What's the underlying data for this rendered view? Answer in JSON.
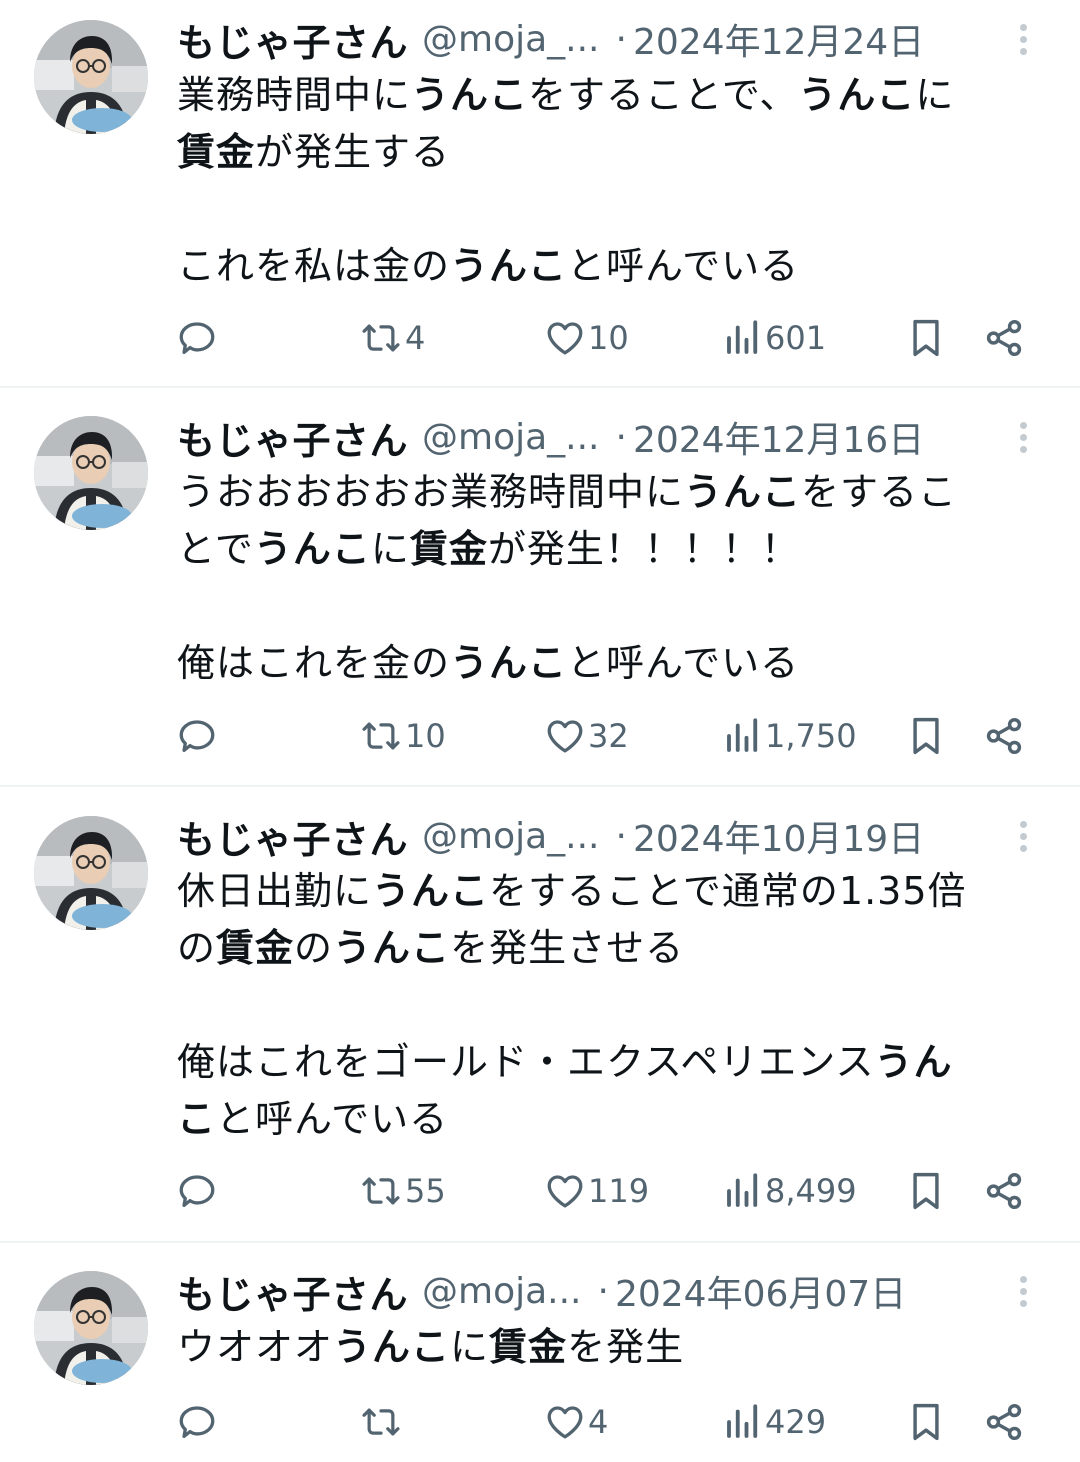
{
  "tweets": [
    {
      "name": "もじゃ子さん",
      "handle": "@moja_...",
      "separator": "·",
      "date": "2024年12月24日",
      "lines": [
        [
          {
            "t": "業務時間中に",
            "b": false
          },
          {
            "t": "うんこ",
            "b": true
          },
          {
            "t": "をすることで、",
            "b": false
          },
          {
            "t": "うんこ",
            "b": true
          },
          {
            "t": "に",
            "b": false
          }
        ],
        [
          {
            "t": "賃金",
            "b": true
          },
          {
            "t": "が発生する",
            "b": false
          }
        ],
        [],
        [
          {
            "t": "これを私は金の",
            "b": false
          },
          {
            "t": "うんこ",
            "b": true
          },
          {
            "t": "と呼んでいる",
            "b": false
          }
        ]
      ],
      "stats": {
        "retweets": "4",
        "likes": "10",
        "views": "601"
      }
    },
    {
      "name": "もじゃ子さん",
      "handle": "@moja_...",
      "separator": "·",
      "date": "2024年12月16日",
      "lines": [
        [
          {
            "t": "うおおおおおお業務時間中に",
            "b": false
          },
          {
            "t": "うんこ",
            "b": true
          },
          {
            "t": "をするこ",
            "b": false
          }
        ],
        [
          {
            "t": "とで",
            "b": false
          },
          {
            "t": "うんこ",
            "b": true
          },
          {
            "t": "に",
            "b": false
          },
          {
            "t": "賃金",
            "b": true
          },
          {
            "t": "が発生！！！！！",
            "b": false
          }
        ],
        [],
        [
          {
            "t": "俺はこれを金の",
            "b": false
          },
          {
            "t": "うんこ",
            "b": true
          },
          {
            "t": "と呼んでいる",
            "b": false
          }
        ]
      ],
      "stats": {
        "retweets": "10",
        "likes": "32",
        "views": "1,750"
      }
    },
    {
      "name": "もじゃ子さん",
      "handle": "@moja_...",
      "separator": "·",
      "date": "2024年10月19日",
      "lines": [
        [
          {
            "t": "休日出勤に",
            "b": false
          },
          {
            "t": "うんこ",
            "b": true
          },
          {
            "t": "をすることで通常の1.35倍",
            "b": false
          }
        ],
        [
          {
            "t": "の",
            "b": false
          },
          {
            "t": "賃金",
            "b": true
          },
          {
            "t": "の",
            "b": false
          },
          {
            "t": "うんこ",
            "b": true
          },
          {
            "t": "を発生させる",
            "b": false
          }
        ],
        [],
        [
          {
            "t": "俺はこれをゴールド・エクスペリエンス",
            "b": false
          },
          {
            "t": "うん",
            "b": true
          }
        ],
        [
          {
            "t": "こ",
            "b": true
          },
          {
            "t": "と呼んでいる",
            "b": false
          }
        ]
      ],
      "stats": {
        "retweets": "55",
        "likes": "119",
        "views": "8,499"
      }
    },
    {
      "name": "もじゃ子さん",
      "handle": "@moja...",
      "separator": "·",
      "date": "2024年06月07日",
      "lines": [
        [
          {
            "t": "ウオオオ",
            "b": false
          },
          {
            "t": "うんこ",
            "b": true
          },
          {
            "t": "に",
            "b": false
          },
          {
            "t": "賃金",
            "b": true
          },
          {
            "t": "を発生",
            "b": false
          }
        ]
      ],
      "stats": {
        "retweets": "",
        "likes": "4",
        "views": "429"
      }
    }
  ],
  "icons": {
    "reply": "reply-icon",
    "retweet": "retweet-icon",
    "like": "like-icon",
    "views": "views-icon",
    "bookmark": "bookmark-icon",
    "share": "share-icon",
    "more": "more-options-icon"
  },
  "colors": {
    "text": "#0f1419",
    "secondary": "#536471",
    "divider": "#eff3f4",
    "scrollbar": "#c4cbd0"
  }
}
